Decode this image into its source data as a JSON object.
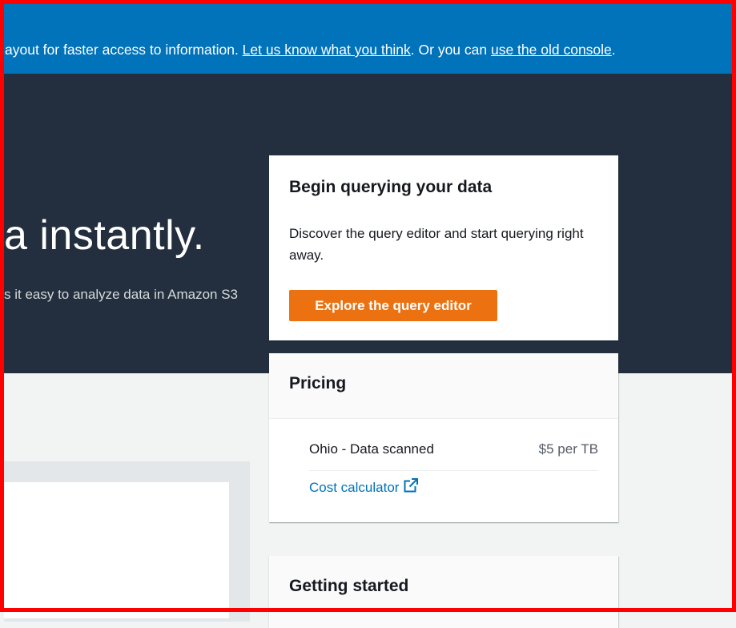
{
  "banner": {
    "text_before": "ayout for faster access to information. ",
    "feedback_link": "Let us know what you think",
    "text_middle": ". Or you can ",
    "old_console_link": "use the old console",
    "text_after": "."
  },
  "hero": {
    "title_fragment": "a instantly.",
    "subtitle_fragment": "s it easy to analyze data in Amazon S3"
  },
  "begin_card": {
    "title": "Begin querying your data",
    "description": "Discover the query editor and start querying right away.",
    "button_label": "Explore the query editor"
  },
  "pricing_card": {
    "title": "Pricing",
    "row_label": "Ohio - Data scanned",
    "row_value": "$5 per TB",
    "calculator_link": "Cost calculator"
  },
  "getting_started_card": {
    "title": "Getting started"
  },
  "colors": {
    "banner_blue": "#0073bb",
    "hero_dark": "#232f3e",
    "button_orange": "#ec7211",
    "link_blue": "#0073bb",
    "frame_red": "#ff0000"
  },
  "icons": {
    "external_link": "external-link-icon"
  }
}
